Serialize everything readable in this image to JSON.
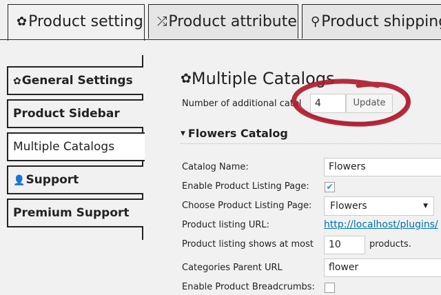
{
  "tabs": [
    {
      "icon": "gear-icon",
      "glyph": "✿",
      "label": "Product settings",
      "active": true
    },
    {
      "icon": "shuffle-icon",
      "glyph": "⤮",
      "label": "Product attributes",
      "active": false
    },
    {
      "icon": "location-pin-icon",
      "glyph": "⚲",
      "label": "Product shipping",
      "active": false
    }
  ],
  "sidebar": {
    "items": [
      {
        "icon": "gear-icon",
        "glyph": "✿",
        "label": "General Settings"
      },
      {
        "icon": "",
        "glyph": "",
        "label": "Product Sidebar"
      },
      {
        "icon": "",
        "glyph": "",
        "label": "Multiple Catalogs"
      },
      {
        "icon": "user-icon",
        "glyph": "👤",
        "label": "Support"
      },
      {
        "icon": "",
        "glyph": "",
        "label": "Premium Support"
      }
    ],
    "active_index": 2
  },
  "main": {
    "title_glyph": "✿",
    "title": "Multiple Catalogs",
    "num_catalogs_label": "Number of additional catal",
    "num_catalogs_value": "4",
    "update_label": "Update",
    "catalog_heading": "Flowers Catalog",
    "fields": {
      "catalog_name_label": "Catalog Name:",
      "catalog_name_value": "Flowers",
      "enable_listing_label": "Enable Product Listing Page:",
      "enable_listing_checked": true,
      "choose_listing_label": "Choose Product Listing Page:",
      "choose_listing_value": "Flowers",
      "listing_url_label": "Product listing URL:",
      "listing_url_value": "http://localhost/plugins/",
      "listing_shows_label": "Product listing shows at most",
      "listing_shows_value": "10",
      "listing_shows_suffix": "products.",
      "categories_parent_label": "Categories Parent URL",
      "categories_parent_value": "flower",
      "enable_breadcrumbs_label": "Enable Product Breadcrumbs:",
      "enable_breadcrumbs_checked": false
    }
  },
  "colors": {
    "annotation_circle": "#b01c2e",
    "link": "#0073aa",
    "check": "#1e8cbe"
  }
}
